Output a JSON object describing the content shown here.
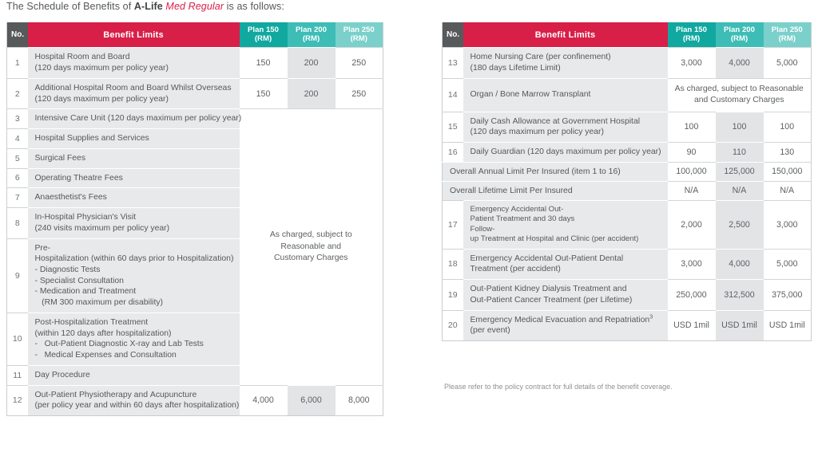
{
  "intro": {
    "prefix": "The Schedule of Benefits of ",
    "brand_bold": "A-Life",
    "brand_italic": " Med Regular",
    "suffix": " is as follows:"
  },
  "colors": {
    "header_no": "#58595b",
    "header_benefit": "#d81f48",
    "plan150": "#11a8a0",
    "plan200": "#3dbdb6",
    "plan250": "#7bd0cb",
    "benefit_cell_bg": "#e8e9ea",
    "alt_value_bg": "#e3e4e6",
    "text": "#54585a"
  },
  "headers": {
    "no": "No.",
    "benefit": "Benefit Limits",
    "plan150": "Plan 150\n(RM)",
    "plan150_line1": "Plan 150",
    "plan150_line2": "(RM)",
    "plan200_line1": "Plan 200",
    "plan200_line2": "(RM)",
    "plan250_line1": "Plan 250",
    "plan250_line2": "(RM)"
  },
  "as_charged_left": "As charged, subject to\nReasonable and\nCustomary Charges",
  "as_charged_left_l1": "As charged, subject to",
  "as_charged_left_l2": "Reasonable and",
  "as_charged_left_l3": "Customary Charges",
  "as_charged_right_l1": "As charged, subject to Reasonable",
  "as_charged_right_l2": "and Customary Charges",
  "left_rows": [
    {
      "no": "1",
      "benefit_l1": "Hospital Room and Board",
      "benefit_l2": "(120 days maximum per policy year)",
      "p150": "150",
      "p200": "200",
      "p250": "250"
    },
    {
      "no": "2",
      "benefit_l1": "Additional Hospital Room and Board Whilst Overseas",
      "benefit_l2": "(120 days maximum per policy year)",
      "p150": "150",
      "p200": "200",
      "p250": "250"
    },
    {
      "no": "3",
      "benefit_l1": "Intensive Care Unit (120 days maximum per policy year)",
      "benefit_l2": ""
    },
    {
      "no": "4",
      "benefit_l1": "Hospital Supplies and Services",
      "benefit_l2": ""
    },
    {
      "no": "5",
      "benefit_l1": "Surgical Fees",
      "benefit_l2": ""
    },
    {
      "no": "6",
      "benefit_l1": "Operating Theatre Fees",
      "benefit_l2": ""
    },
    {
      "no": "7",
      "benefit_l1": "Anaesthetist's Fees",
      "benefit_l2": ""
    },
    {
      "no": "8",
      "benefit_l1": "In-Hospital Physician's Visit",
      "benefit_l2": "(240 visits maximum per policy year)"
    },
    {
      "no": "9",
      "benefit_l1": "Pre-Hospitalization (within 60 days prior to Hospitalization)",
      "benefit_l2": "- Diagnostic Tests",
      "benefit_l3": "- Specialist Consultation",
      "benefit_l4": "- Medication and Treatment",
      "benefit_l5": "   (RM 300 maximum per disability)"
    },
    {
      "no": "10",
      "benefit_l1": "Post-Hospitalization Treatment",
      "benefit_l2": "(within 120 days after hospitalization)",
      "benefit_l3": "-   Out-Patient Diagnostic X-ray and Lab Tests",
      "benefit_l4": "-   Medical Expenses and Consultation"
    },
    {
      "no": "11",
      "benefit_l1": "Day Procedure",
      "benefit_l2": ""
    },
    {
      "no": "12",
      "benefit_l1": "Out-Patient Physiotherapy and Acupuncture",
      "benefit_l2": "(per policy year and within 60 days after hospitalization)",
      "p150": "4,000",
      "p200": "6,000",
      "p250": "8,000"
    }
  ],
  "right_rows": [
    {
      "no": "13",
      "benefit_l1": "Home Nursing Care (per confinement)",
      "benefit_l2": "(180 days Lifetime Limit)",
      "p150": "3,000",
      "p200": "4,000",
      "p250": "5,000"
    },
    {
      "no": "14",
      "benefit_l1": "Organ / Bone Marrow Transplant",
      "benefit_l2": "",
      "merged": true
    },
    {
      "no": "15",
      "benefit_l1": "Daily Cash Allowance at Government Hospital",
      "benefit_l2": "(120 days maximum per policy year)",
      "p150": "100",
      "p200": "100",
      "p250": "100"
    },
    {
      "no": "16",
      "benefit_l1": "Daily Guardian (120 days maximum per policy year)",
      "benefit_l2": "",
      "p150": "90",
      "p200": "110",
      "p250": "130"
    },
    {
      "no": "",
      "benefit_l1": "Overall Annual Limit Per Insured (item 1 to 16)",
      "benefit_l2": "",
      "span": true,
      "p150": "100,000",
      "p200": "125,000",
      "p250": "150,000"
    },
    {
      "no": "",
      "benefit_l1": "Overall Lifetime Limit Per Insured",
      "benefit_l2": "",
      "span": true,
      "p150": "N/A",
      "p200": "N/A",
      "p250": "N/A"
    },
    {
      "no": "17",
      "benefit_l1": "Emergency Accidental Out-Patient Treatment and 30 days",
      "benefit_l2": "Follow-up Treatment at Hospital and Clinic (per accident)",
      "p150": "2,000",
      "p200": "2,500",
      "p250": "3,000",
      "small": true
    },
    {
      "no": "18",
      "benefit_l1": "Emergency Accidental Out-Patient Dental",
      "benefit_l2": "Treatment (per accident)",
      "p150": "3,000",
      "p200": "4,000",
      "p250": "5,000"
    },
    {
      "no": "19",
      "benefit_l1": "Out-Patient Kidney Dialysis Treatment and",
      "benefit_l2": "Out-Patient Cancer Treatment (per Lifetime)",
      "p150": "250,000",
      "p200": "312,500",
      "p250": "375,000"
    },
    {
      "no": "20",
      "benefit_l1": "Emergency Medical Evacuation and Repatriation",
      "benefit_sup": "3",
      "benefit_l2": "(per event)",
      "p150": "USD 1mil",
      "p200": "USD 1mil",
      "p250": "USD 1mil"
    }
  ],
  "footnote": "Please refer to the policy contract for full details of the benefit coverage."
}
